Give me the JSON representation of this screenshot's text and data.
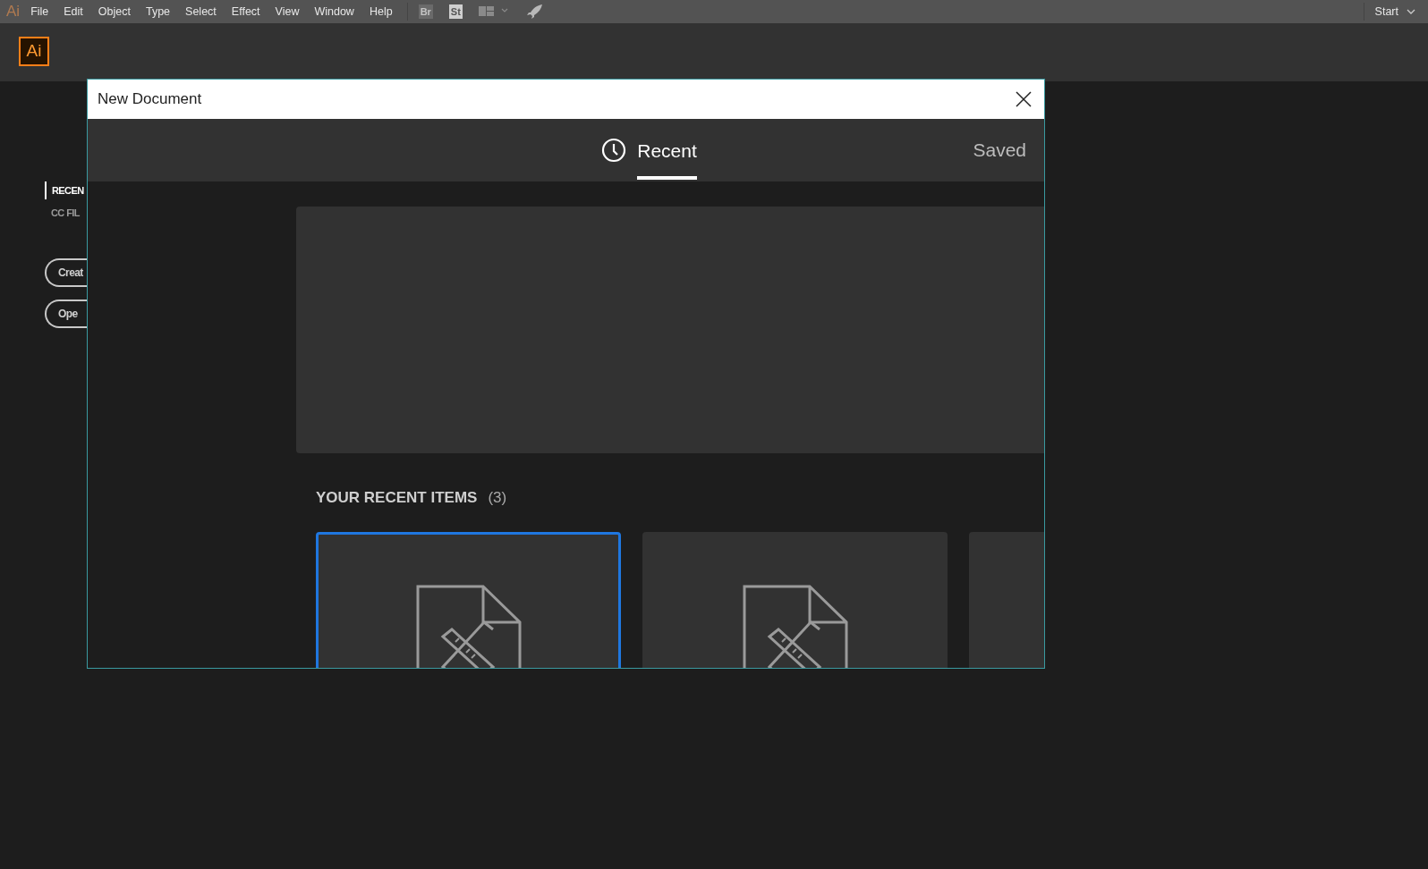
{
  "app_logo": "Ai",
  "menu": [
    "File",
    "Edit",
    "Object",
    "Type",
    "Select",
    "Effect",
    "View",
    "Window",
    "Help"
  ],
  "toolbar": {
    "bridge": "Br",
    "stock": "St"
  },
  "workspace": "Start",
  "header_logo": "Ai",
  "home": {
    "nav": [
      {
        "label": "RECEN",
        "selected": true
      },
      {
        "label": "CC FIL",
        "selected": false
      }
    ],
    "buttons": [
      "Creat",
      "Ope"
    ]
  },
  "dialog": {
    "title": "New Document",
    "tabs": [
      {
        "label": "Recent",
        "selected": true,
        "kind": "clock"
      },
      {
        "label": "Saved",
        "selected": false,
        "kind": "plain"
      }
    ],
    "recent": {
      "heading": "YOUR RECENT ITEMS",
      "count": "(3)",
      "items": [
        {
          "selected": true
        },
        {
          "selected": false
        },
        {
          "selected": false
        }
      ]
    }
  }
}
